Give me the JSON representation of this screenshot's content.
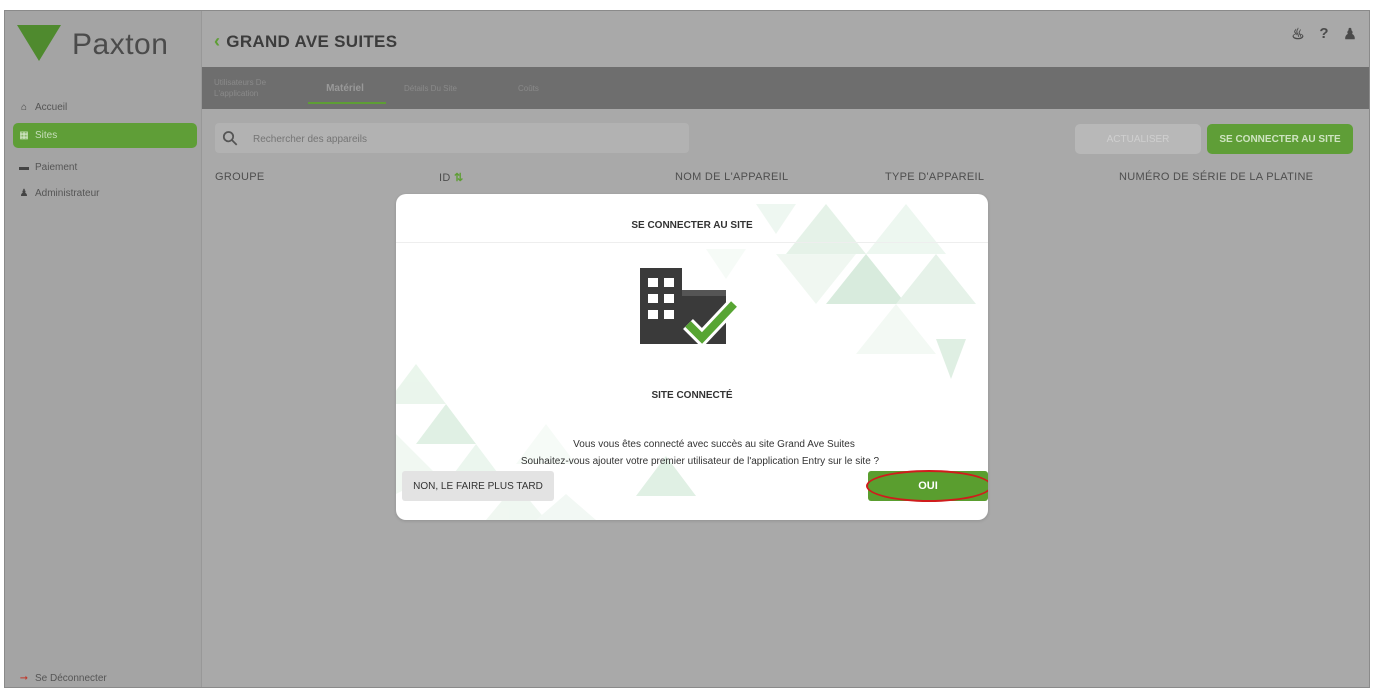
{
  "app": {
    "logo_text": "Paxton",
    "site_title": "GRAND AVE SUITES"
  },
  "sidebar": {
    "items": [
      {
        "label": "Accueil",
        "icon": "home-icon"
      },
      {
        "label": "Sites",
        "icon": "building-icon",
        "active": true
      },
      {
        "label": "Paiement",
        "icon": "credit-card-icon"
      },
      {
        "label": "Administrateur",
        "icon": "user-icon"
      }
    ],
    "logout_label": "Se Déconnecter"
  },
  "tabs": [
    {
      "label": "Utilisateurs De L'application"
    },
    {
      "label": "Matériel",
      "active": true
    },
    {
      "label": "Détails Du Site"
    },
    {
      "label": "Coûts"
    }
  ],
  "toolbar": {
    "search_placeholder": "Rechercher des appareils",
    "refresh_label": "ACTUALISER",
    "connect_label": "SE CONNECTER AU SITE"
  },
  "table": {
    "columns": [
      "GROUPE",
      "ID",
      "NOM DE L'APPAREIL",
      "TYPE D'APPAREIL",
      "NUMÉRO DE SÉRIE DE LA PLATINE"
    ],
    "id_sort_glyph": "⇅"
  },
  "modal": {
    "title": "SE CONNECTER AU SITE",
    "status": "SITE CONNECTÉ",
    "message_line1": "Vous vous êtes connecté avec succès au site Grand Ave Suites",
    "message_line2": "Souhaitez-vous ajouter votre premier utilisateur de l'application Entry sur le site ?",
    "later_label": "NON, LE FAIRE PLUS TARD",
    "yes_label": "OUI"
  },
  "colors": {
    "brand_green": "#5f9e37",
    "overlay_gray": "#a9a9a9",
    "highlight_red": "#d01c1c"
  }
}
